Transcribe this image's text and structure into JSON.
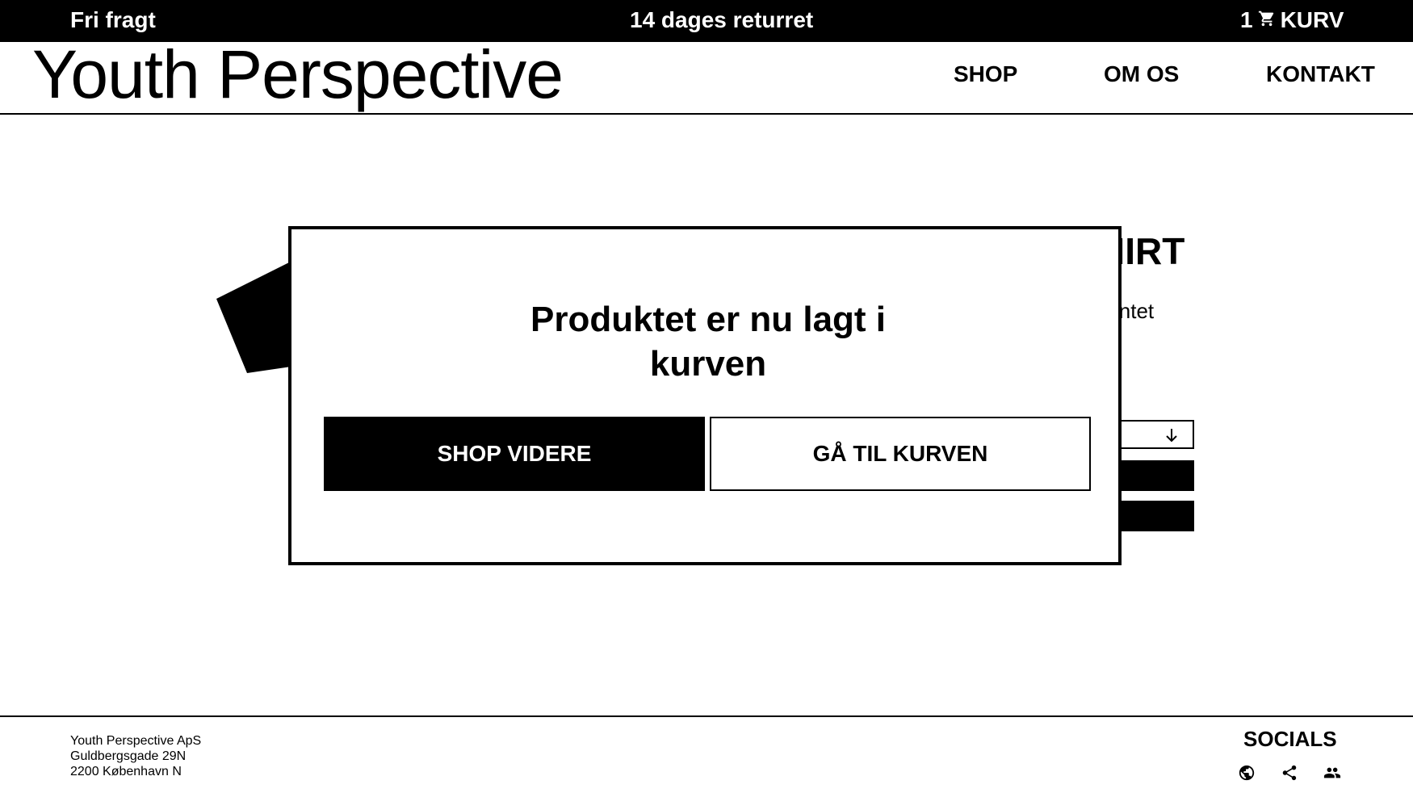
{
  "topbar": {
    "shipping_text": "Fri fragt",
    "returns_text": "14 dages returret",
    "cart_count": "1",
    "cart_label": "KURV"
  },
  "header": {
    "logo": "Youth Perspective",
    "nav": [
      "SHOP",
      "OM OS",
      "KONTAKT"
    ]
  },
  "product": {
    "title_partial": "HIRT",
    "description_partial": "intet"
  },
  "modal": {
    "heading_line1": "Produktet er nu lagt i",
    "heading_line2": "kurven",
    "continue_label": "SHOP VIDERE",
    "go_to_cart_label": "GÅ TIL KURVEN"
  },
  "footer": {
    "company": "Youth Perspective ApS",
    "street": "Guldbergsgade 29N",
    "city": "2200 København N",
    "socials_title": "SOCIALS",
    "social_icons": [
      "globe-icon",
      "share-icon",
      "people-icon"
    ]
  }
}
